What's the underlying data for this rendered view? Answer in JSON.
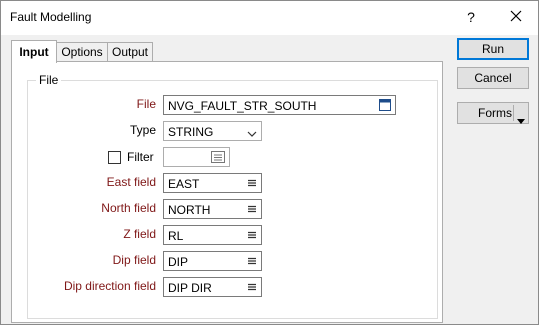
{
  "window": {
    "title": "Fault Modelling",
    "help_label": "?"
  },
  "tabs": [
    {
      "label": "Input",
      "active": true
    },
    {
      "label": "Options",
      "active": false
    },
    {
      "label": "Output",
      "active": false
    }
  ],
  "group": {
    "label": "File"
  },
  "fields": {
    "file": {
      "label": "File",
      "value": "NVG_FAULT_STR_SOUTH",
      "required": true
    },
    "type": {
      "label": "Type",
      "value": "STRING"
    },
    "filter": {
      "label": "Filter",
      "value": "",
      "checked": false
    },
    "east": {
      "label": "East field",
      "value": "EAST",
      "required": true
    },
    "north": {
      "label": "North field",
      "value": "NORTH",
      "required": true
    },
    "z": {
      "label": "Z field",
      "value": "RL",
      "required": true
    },
    "dip": {
      "label": "Dip field",
      "value": "DIP",
      "required": true
    },
    "dip_direction": {
      "label": "Dip direction field",
      "value": "DIP DIR",
      "required": true
    }
  },
  "buttons": {
    "run": "Run",
    "cancel": "Cancel",
    "forms": "Forms"
  },
  "colors": {
    "required_label": "#7f1717",
    "default_button_border": "#0078d7"
  }
}
